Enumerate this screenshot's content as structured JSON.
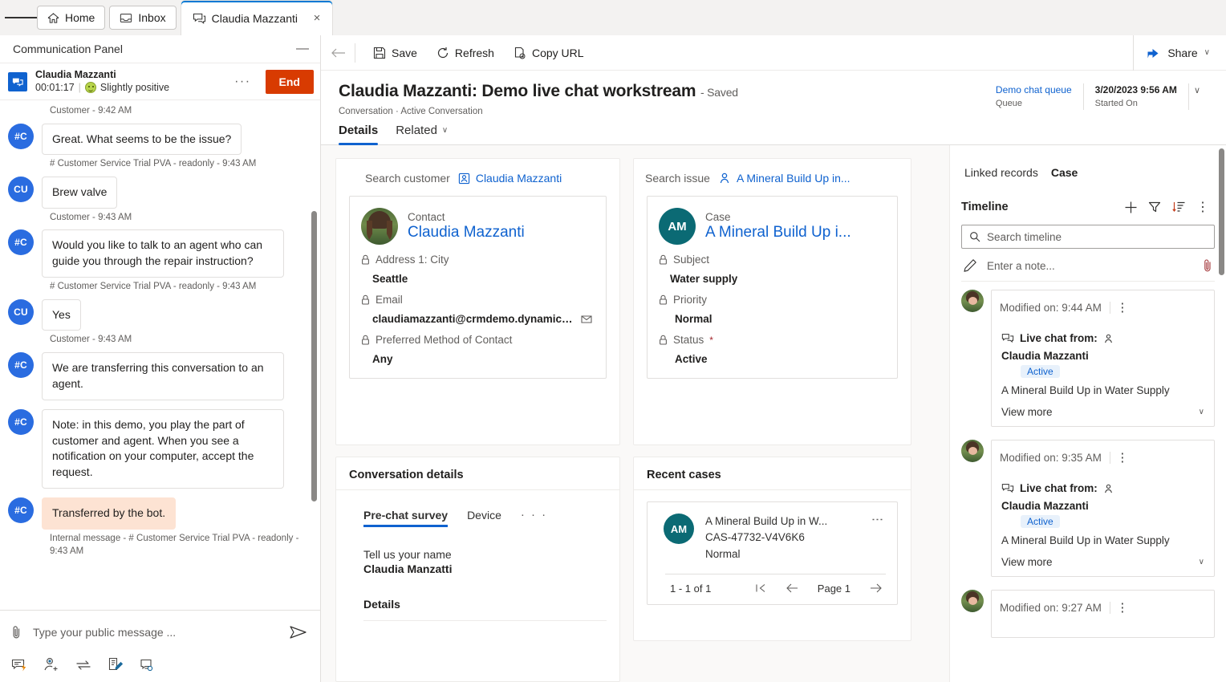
{
  "tabbar": {
    "menu_icon": "hamburger-icon",
    "tabs": [
      {
        "label": "Home",
        "icon": "home-icon",
        "active": false
      },
      {
        "label": "Inbox",
        "icon": "inbox-icon",
        "active": false
      },
      {
        "label": "Claudia Mazzanti",
        "icon": "chat-icon",
        "active": true,
        "close": "×"
      }
    ]
  },
  "comm_panel": {
    "title": "Communication Panel",
    "minimize": "—",
    "conversation": {
      "name": "Claudia Mazzanti",
      "timer": "00:01:17",
      "separator": "|",
      "sentiment": "Slightly positive",
      "overflow": "···",
      "end_label": "End"
    },
    "transcript": [
      {
        "kind": "stamp",
        "text": "Customer - 9:42 AM"
      },
      {
        "kind": "message",
        "avatar": "#C",
        "text": "Great. What seems to be the issue?",
        "stamp": "# Customer Service Trial PVA - readonly - 9:43 AM",
        "internal": false
      },
      {
        "kind": "message",
        "avatar": "CU",
        "text": "Brew valve",
        "stamp": "Customer - 9:43 AM",
        "internal": false
      },
      {
        "kind": "message",
        "avatar": "#C",
        "text": "Would you like to talk to an agent who can guide you through the repair instruction?",
        "stamp": "# Customer Service Trial PVA - readonly - 9:43 AM",
        "internal": false
      },
      {
        "kind": "message",
        "avatar": "CU",
        "text": "Yes",
        "stamp": "Customer - 9:43 AM",
        "internal": false
      },
      {
        "kind": "message",
        "avatar": "#C",
        "text": "We are transferring this conversation to an agent.",
        "stamp": "",
        "internal": false
      },
      {
        "kind": "message",
        "avatar": "#C",
        "text": "Note: in this demo, you play the part of customer and agent. When you see a notification on your computer, accept the request.",
        "stamp": "",
        "internal": false
      },
      {
        "kind": "message",
        "avatar": "#C",
        "text": "Transferred by the bot.",
        "stamp": "Internal message - # Customer Service Trial PVA - readonly - 9:43 AM",
        "internal": true
      }
    ],
    "composer": {
      "attach_icon": "paperclip-icon",
      "placeholder": "Type your public message ...",
      "send_icon": "send-icon",
      "tools": [
        {
          "name": "quick-replies-icon"
        },
        {
          "name": "add-agent-icon"
        },
        {
          "name": "transfer-icon"
        },
        {
          "name": "notes-icon"
        },
        {
          "name": "consult-icon"
        }
      ]
    }
  },
  "commandbar": {
    "back_icon": "back-arrow-icon",
    "items": [
      {
        "label": "Save",
        "icon": "save-icon"
      },
      {
        "label": "Refresh",
        "icon": "refresh-icon"
      },
      {
        "label": "Copy URL",
        "icon": "copy-url-icon"
      }
    ],
    "share": {
      "label": "Share",
      "icon": "share-icon",
      "chevron": "∨"
    }
  },
  "record": {
    "title": "Claudia Mazzanti: Demo live chat workstream",
    "saved": "- Saved",
    "breadcrumb": "Conversation · Active Conversation",
    "header_fields": [
      {
        "value": "Demo chat queue",
        "label": "Queue",
        "link": true
      },
      {
        "value": "3/20/2023 9:56 AM",
        "label": "Started On",
        "link": false
      }
    ],
    "header_chevron": "∨",
    "tabs": [
      {
        "label": "Details",
        "active": true,
        "chevron": ""
      },
      {
        "label": "Related",
        "active": false,
        "chevron": "∨"
      }
    ]
  },
  "customer_panel": {
    "search_label": "Search customer",
    "search_value": "Claudia Mazzanti",
    "search_icon": "contact-icon",
    "card": {
      "entity": "Contact",
      "name": "Claudia Mazzanti",
      "avatar": "photo-avatar",
      "fields": [
        {
          "label": "Address 1: City",
          "value": "Seattle",
          "lock": true,
          "trailing_icon": ""
        },
        {
          "label": "Email",
          "value": "claudiamazzanti@crmdemo.dynamics....",
          "lock": true,
          "trailing_icon": "email-icon"
        },
        {
          "label": "Preferred Method of Contact",
          "value": "Any",
          "lock": true,
          "trailing_icon": ""
        }
      ]
    }
  },
  "issue_panel": {
    "search_label": "Search issue",
    "search_value": "A Mineral Build Up in...",
    "search_icon": "case-contact-icon",
    "card": {
      "entity": "Case",
      "name": "A Mineral Build Up i...",
      "initials": "AM",
      "fields": [
        {
          "label": "Subject",
          "value": "Water supply",
          "lock": true,
          "required": false
        },
        {
          "label": "Priority",
          "value": "Normal",
          "lock": true,
          "required": false
        },
        {
          "label": "Status",
          "value": "Active",
          "lock": true,
          "required": true
        }
      ]
    }
  },
  "conversation_details": {
    "title": "Conversation details",
    "tabs": [
      {
        "label": "Pre-chat survey",
        "active": true
      },
      {
        "label": "Device",
        "active": false
      },
      {
        "label": "· · ·",
        "active": false,
        "more": true
      }
    ],
    "survey": {
      "question": "Tell us your name",
      "answer": "Claudia Manzatti"
    },
    "details_header": "Details"
  },
  "recent_cases": {
    "title": "Recent cases",
    "items": [
      {
        "initials": "AM",
        "title": "A Mineral Build Up in W...",
        "number": "CAS-47732-V4V6K6",
        "priority": "Normal",
        "overflow": "⋮"
      }
    ],
    "pager": {
      "count": "1 - 1 of 1",
      "first_icon": "first-page-icon",
      "prev_icon": "prev-page-icon",
      "page_label": "Page 1",
      "next_icon": "next-page-icon"
    }
  },
  "timeline_panel": {
    "linked_label": "Linked records",
    "linked_value": "Case",
    "title": "Timeline",
    "actions": [
      {
        "name": "add-icon",
        "glyph": "+"
      },
      {
        "name": "filter-icon",
        "glyph": "filter"
      },
      {
        "name": "sort-icon",
        "glyph": "sort"
      },
      {
        "name": "more-icon",
        "glyph": "⋮"
      }
    ],
    "search_placeholder": "Search timeline",
    "search_icon": "search-icon",
    "note_placeholder": "Enter a note...",
    "note_icon": "pencil-icon",
    "note_attach_icon": "paperclip-icon",
    "items": [
      {
        "modified": "Modified on: 9:44 AM",
        "overflow": "⋮",
        "channel_icon": "live-chat-icon",
        "from_label": "Live chat from:",
        "person_icon": "person-icon",
        "person": "Claudia Mazzanti",
        "status": "Active",
        "description": "A Mineral Build Up in Water Supply",
        "view_more": "View more",
        "chevron": "∨"
      },
      {
        "modified": "Modified on: 9:35 AM",
        "overflow": "⋮",
        "channel_icon": "live-chat-icon",
        "from_label": "Live chat from:",
        "person_icon": "person-icon",
        "person": "Claudia Mazzanti",
        "status": "Active",
        "description": "A Mineral Build Up in Water Supply",
        "view_more": "View more",
        "chevron": "∨"
      },
      {
        "modified": "Modified on: 9:27 AM",
        "overflow": "⋮",
        "channel_icon": "live-chat-icon",
        "from_label": "",
        "person_icon": "person-icon",
        "person": "",
        "status": "",
        "description": "",
        "view_more": "",
        "chevron": ""
      }
    ]
  },
  "colors": {
    "accent": "#0f62cf",
    "end_button": "#d83b01",
    "case_avatar": "#0b6a74",
    "bot_avatar": "#2a6ce0",
    "internal_bubble": "#fde3d3",
    "badge_bg": "#e8f1fb"
  }
}
